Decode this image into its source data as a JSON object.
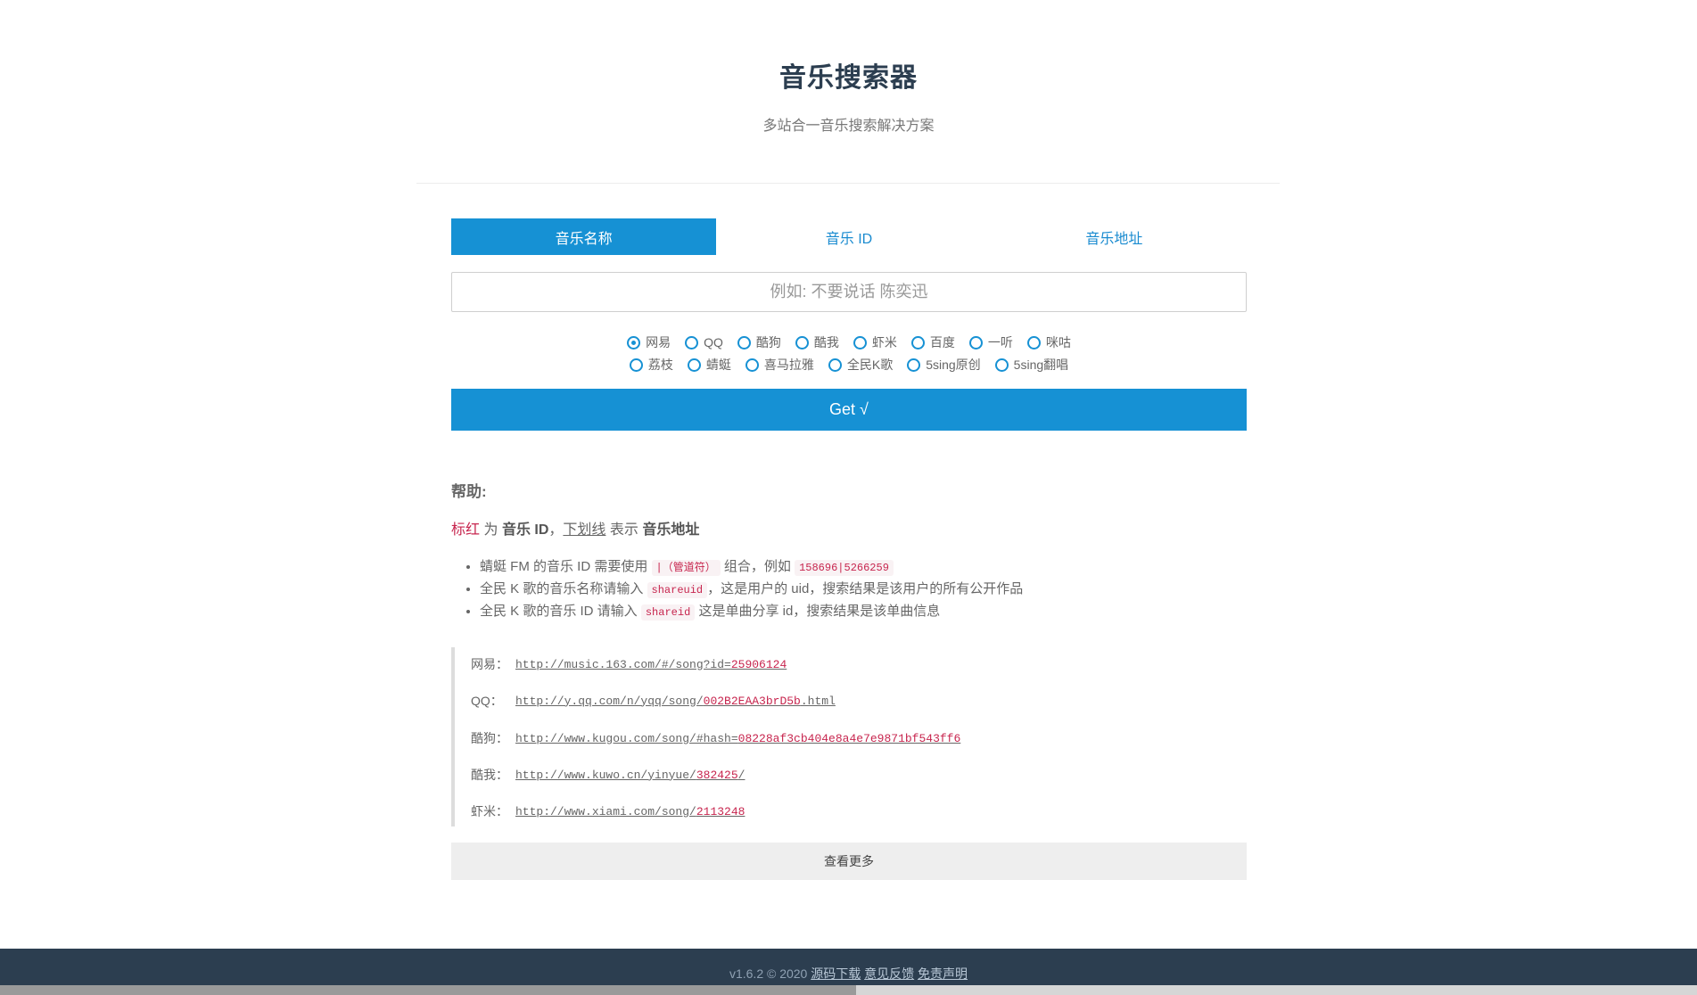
{
  "header": {
    "title": "音乐搜索器",
    "subtitle": "多站合一音乐搜索解决方案"
  },
  "tabs": [
    {
      "label": "音乐名称",
      "active": true
    },
    {
      "label": "音乐 ID",
      "active": false
    },
    {
      "label": "音乐地址",
      "active": false
    }
  ],
  "search": {
    "value": "",
    "placeholder": "例如: 不要说话 陈奕迅"
  },
  "sources": {
    "row1": [
      "网易",
      "QQ",
      "酷狗",
      "酷我",
      "虾米",
      "百度",
      "一听",
      "咪咕"
    ],
    "row2": [
      "荔枝",
      "蜻蜓",
      "喜马拉雅",
      "全民K歌",
      "5sing原创",
      "5sing翻唱"
    ],
    "selected": "网易"
  },
  "get_button": "Get √",
  "help": {
    "title": "帮助:",
    "line": {
      "red_word": "标红",
      "is": "为",
      "music_id": "音乐 ID",
      "sep": "，",
      "underline_word": "下划线",
      "means": "表示",
      "music_url": "音乐地址"
    },
    "tips": [
      {
        "before": "蜻蜓 FM 的音乐 ID 需要使用",
        "code": "|（管道符）",
        "middle": "组合，例如",
        "code2": "158696|5266259",
        "after": ""
      },
      {
        "before": "全民 K 歌的音乐名称请输入",
        "code": "shareuid",
        "middle": "，这是用户的 uid，搜索结果是该用户的所有公开作品",
        "code2": "",
        "after": ""
      },
      {
        "before": "全民 K 歌的音乐 ID 请输入",
        "code": "shareid",
        "middle": "这是单曲分享 id，搜索结果是该单曲信息",
        "code2": "",
        "after": ""
      }
    ]
  },
  "examples": [
    {
      "label": "网易：",
      "prefix": "http://music.163.com/#/song?id=",
      "id": "25906124",
      "suffix": ""
    },
    {
      "label": "QQ：",
      "prefix": "http://y.qq.com/n/yqq/song/",
      "id": "002B2EAA3brD5b",
      "suffix": ".html"
    },
    {
      "label": "酷狗：",
      "prefix": "http://www.kugou.com/song/#hash=",
      "id": "08228af3cb404e8a4e7e9871bf543ff6",
      "suffix": ""
    },
    {
      "label": "酷我：",
      "prefix": "http://www.kuwo.cn/yinyue/",
      "id": "382425",
      "suffix": "/"
    },
    {
      "label": "虾米：",
      "prefix": "http://www.xiami.com/song/",
      "id": "2113248",
      "suffix": ""
    }
  ],
  "more_button": "查看更多",
  "footer": {
    "version": "v1.6.2 © 2020",
    "link1": "源码下载",
    "link2": "意见反馈",
    "link3": "免责声明"
  }
}
